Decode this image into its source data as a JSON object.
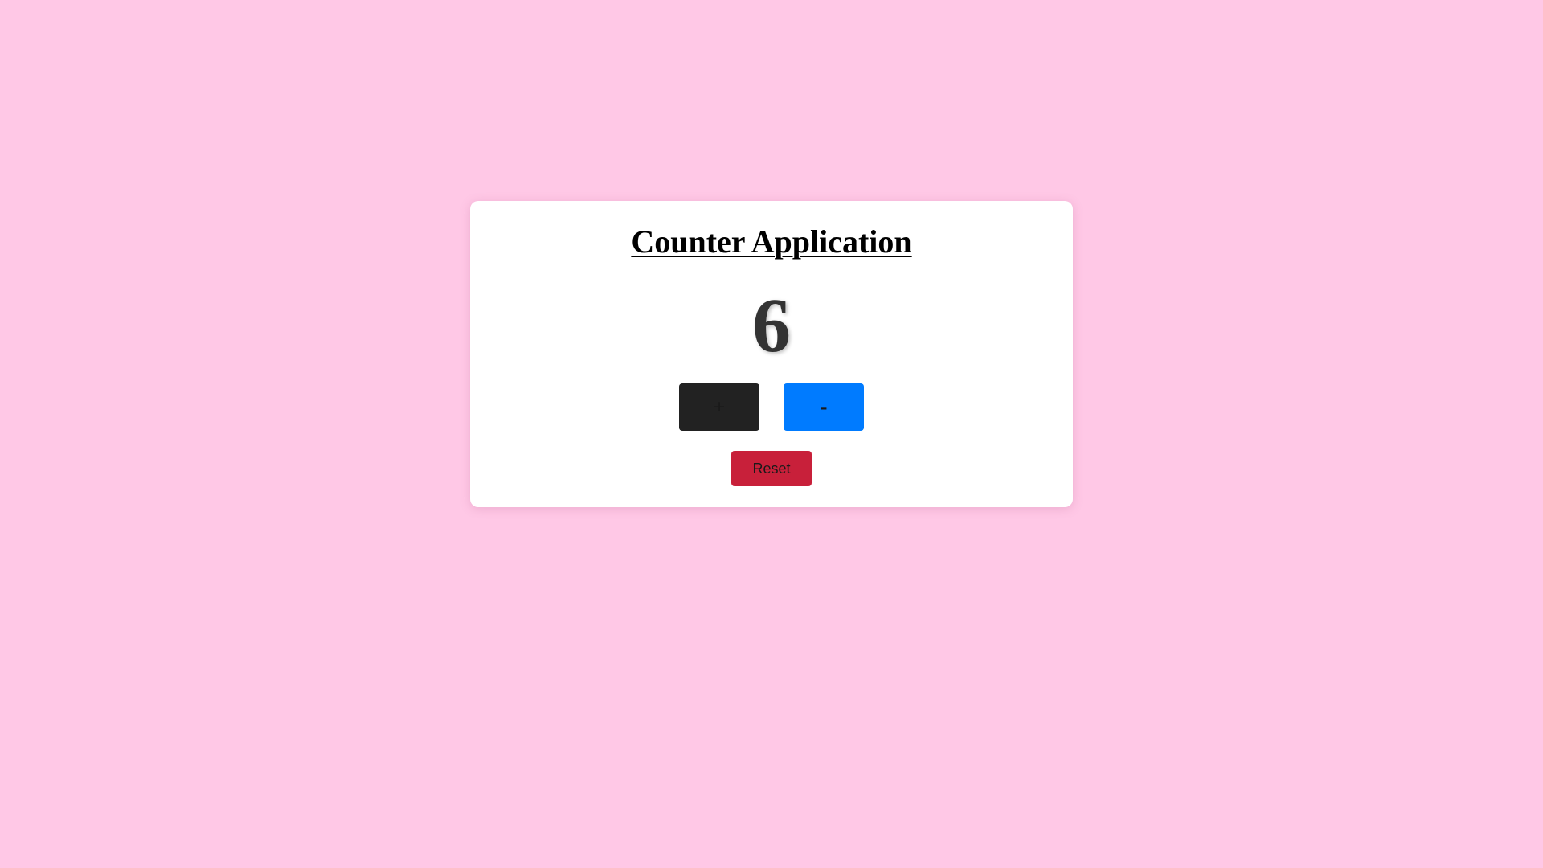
{
  "app": {
    "title": "Counter Application",
    "count": "6"
  },
  "controls": {
    "increment_label": "+",
    "decrement_label": "-",
    "reset_label": "Reset"
  },
  "colors": {
    "background": "#ffc8e6",
    "card": "#ffffff",
    "increment_button": "#222222",
    "decrement_button": "#007bff",
    "reset_button": "#c8203a",
    "count_text": "#333333"
  }
}
